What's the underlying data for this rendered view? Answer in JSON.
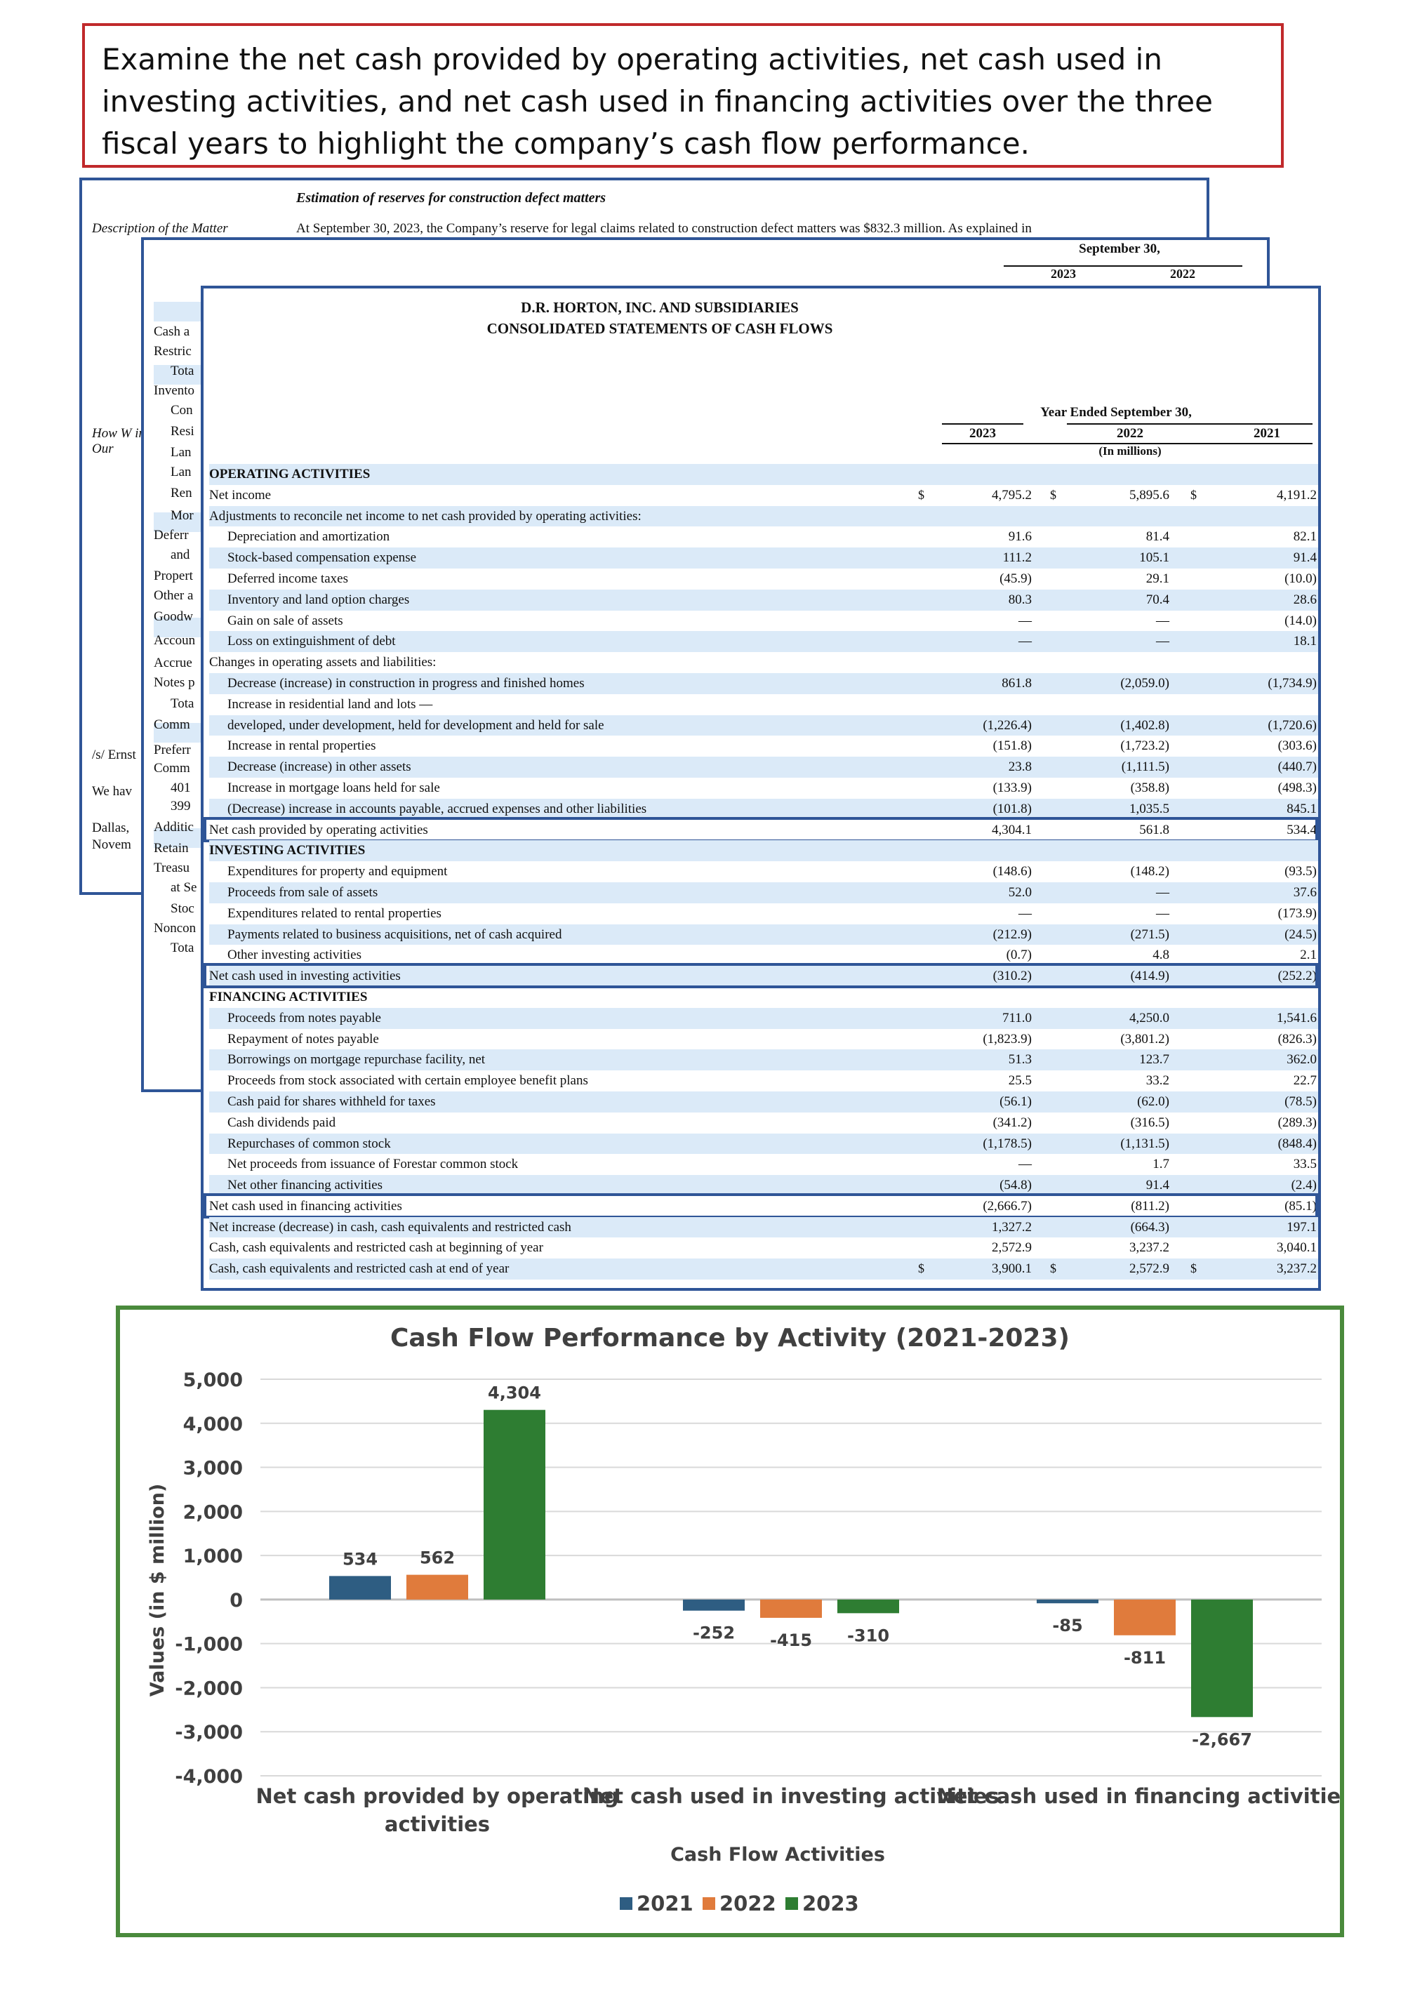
{
  "prompt": {
    "text": "Examine the net cash provided by operating activities, net cash used in investing activities, and net cash used in financing activities over the three fiscal years to highlight the company’s cash flow performance."
  },
  "audit_page": {
    "title": "Estimation of reserves for construction defect matters",
    "description_label": "Description of the Matter",
    "description_text": "At September 30, 2023, the Company’s reserve for legal claims related to construction defect matters was $832.3 million. As explained in",
    "how_label": "How W in Our",
    "left_fragments": [
      "/s/ Ernst",
      "We hav",
      "Dallas,",
      "Novem"
    ]
  },
  "balance_page": {
    "header": "September 30,",
    "years": [
      "2023",
      "2022"
    ],
    "stubs": [
      "Cash a",
      "Restric",
      "Tota",
      "Invento",
      "Con",
      "Resi",
      "Lan",
      "Lan",
      "Ren",
      "Mor",
      "Deferr",
      "and",
      "Propert",
      "Other a",
      "Goodw",
      "Accoun",
      "Accrue",
      "Notes p",
      "Tota",
      "Comm",
      "Preferr",
      "Comm",
      "401",
      "399",
      "Additic",
      "Retain",
      "Treasu",
      "at Se",
      "Stoc",
      "Noncon",
      "Tota"
    ]
  },
  "statement": {
    "title_line1": "D.R. HORTON, INC. AND SUBSIDIARIES",
    "title_line2": "CONSOLIDATED STATEMENTS OF CASH FLOWS",
    "period_header": "Year Ended September 30,",
    "years": [
      "2023",
      "2022",
      "2021"
    ],
    "units": "(In millions)",
    "rows": [
      {
        "label": "OPERATING ACTIVITIES",
        "type": "section"
      },
      {
        "label": "Net income",
        "v2023": "4,795.2",
        "v2022": "5,895.6",
        "v2021": "4,191.2",
        "currency": "$"
      },
      {
        "label": "Adjustments to reconcile net income to net cash provided by operating activities:"
      },
      {
        "label": "Depreciation and amortization",
        "indent": 1,
        "v2023": "91.6",
        "v2022": "81.4",
        "v2021": "82.1"
      },
      {
        "label": "Stock-based compensation expense",
        "indent": 1,
        "v2023": "111.2",
        "v2022": "105.1",
        "v2021": "91.4"
      },
      {
        "label": "Deferred income taxes",
        "indent": 1,
        "v2023": "(45.9)",
        "v2022": "29.1",
        "v2021": "(10.0)"
      },
      {
        "label": "Inventory and land option charges",
        "indent": 1,
        "v2023": "80.3",
        "v2022": "70.4",
        "v2021": "28.6"
      },
      {
        "label": "Gain on sale of assets",
        "indent": 1,
        "v2023": "—",
        "v2022": "—",
        "v2021": "(14.0)"
      },
      {
        "label": "Loss on extinguishment of debt",
        "indent": 1,
        "v2023": "—",
        "v2022": "—",
        "v2021": "18.1"
      },
      {
        "label": "Changes in operating assets and liabilities:"
      },
      {
        "label": "Decrease (increase) in construction in progress and finished homes",
        "indent": 1,
        "v2023": "861.8",
        "v2022": "(2,059.0)",
        "v2021": "(1,734.9)"
      },
      {
        "label": "Increase in residential land and lots —",
        "indent": 1
      },
      {
        "label": "    developed, under development, held for development and held for sale",
        "indent": 1,
        "v2023": "(1,226.4)",
        "v2022": "(1,402.8)",
        "v2021": "(1,720.6)"
      },
      {
        "label": "Increase in rental properties",
        "indent": 1,
        "v2023": "(151.8)",
        "v2022": "(1,723.2)",
        "v2021": "(303.6)"
      },
      {
        "label": "Decrease (increase) in other assets",
        "indent": 1,
        "v2023": "23.8",
        "v2022": "(1,111.5)",
        "v2021": "(440.7)"
      },
      {
        "label": "Increase in mortgage loans held for sale",
        "indent": 1,
        "v2023": "(133.9)",
        "v2022": "(358.8)",
        "v2021": "(498.3)"
      },
      {
        "label": "(Decrease) increase in accounts payable, accrued expenses and other liabilities",
        "indent": 1,
        "v2023": "(101.8)",
        "v2022": "1,035.5",
        "v2021": "845.1"
      },
      {
        "label": "Net cash provided by operating activities",
        "v2023": "4,304.1",
        "v2022": "561.8",
        "v2021": "534.4",
        "total": true
      },
      {
        "label": "INVESTING ACTIVITIES",
        "type": "section"
      },
      {
        "label": "Expenditures for property and equipment",
        "indent": 1,
        "v2023": "(148.6)",
        "v2022": "(148.2)",
        "v2021": "(93.5)"
      },
      {
        "label": "Proceeds from sale of assets",
        "indent": 1,
        "v2023": "52.0",
        "v2022": "—",
        "v2021": "37.6"
      },
      {
        "label": "Expenditures related to rental properties",
        "indent": 1,
        "v2023": "—",
        "v2022": "—",
        "v2021": "(173.9)"
      },
      {
        "label": "Payments related to business acquisitions, net of cash acquired",
        "indent": 1,
        "v2023": "(212.9)",
        "v2022": "(271.5)",
        "v2021": "(24.5)"
      },
      {
        "label": "Other investing activities",
        "indent": 1,
        "v2023": "(0.7)",
        "v2022": "4.8",
        "v2021": "2.1"
      },
      {
        "label": "Net cash used in investing activities",
        "v2023": "(310.2)",
        "v2022": "(414.9)",
        "v2021": "(252.2)",
        "total": true
      },
      {
        "label": "FINANCING ACTIVITIES",
        "type": "section"
      },
      {
        "label": "Proceeds from notes payable",
        "indent": 1,
        "v2023": "711.0",
        "v2022": "4,250.0",
        "v2021": "1,541.6"
      },
      {
        "label": "Repayment of notes payable",
        "indent": 1,
        "v2023": "(1,823.9)",
        "v2022": "(3,801.2)",
        "v2021": "(826.3)"
      },
      {
        "label": "Borrowings on mortgage repurchase facility, net",
        "indent": 1,
        "v2023": "51.3",
        "v2022": "123.7",
        "v2021": "362.0"
      },
      {
        "label": "Proceeds from stock associated with certain employee benefit plans",
        "indent": 1,
        "v2023": "25.5",
        "v2022": "33.2",
        "v2021": "22.7"
      },
      {
        "label": "Cash paid for shares withheld for taxes",
        "indent": 1,
        "v2023": "(56.1)",
        "v2022": "(62.0)",
        "v2021": "(78.5)"
      },
      {
        "label": "Cash dividends paid",
        "indent": 1,
        "v2023": "(341.2)",
        "v2022": "(316.5)",
        "v2021": "(289.3)"
      },
      {
        "label": "Repurchases of common stock",
        "indent": 1,
        "v2023": "(1,178.5)",
        "v2022": "(1,131.5)",
        "v2021": "(848.4)"
      },
      {
        "label": "Net proceeds from issuance of Forestar common stock",
        "indent": 1,
        "v2023": "—",
        "v2022": "1.7",
        "v2021": "33.5"
      },
      {
        "label": "Net other financing activities",
        "indent": 1,
        "v2023": "(54.8)",
        "v2022": "91.4",
        "v2021": "(2.4)"
      },
      {
        "label": "Net cash used in financing activities",
        "v2023": "(2,666.7)",
        "v2022": "(811.2)",
        "v2021": "(85.1)",
        "total": true
      },
      {
        "label": "Net increase (decrease) in cash, cash equivalents and restricted cash",
        "v2023": "1,327.2",
        "v2022": "(664.3)",
        "v2021": "197.1"
      },
      {
        "label": "Cash, cash equivalents and restricted cash at beginning of year",
        "v2023": "2,572.9",
        "v2022": "3,237.2",
        "v2021": "3,040.1"
      },
      {
        "label": "Cash, cash equivalents and restricted cash at end of year",
        "v2023": "3,900.1",
        "v2022": "2,572.9",
        "v2021": "3,237.2",
        "currency": "$"
      }
    ]
  },
  "chart_data": {
    "type": "bar",
    "title": "Cash Flow Performance by Activity (2021-2023)",
    "xlabel": "Cash Flow Activities",
    "ylabel": "Values (in $ million)",
    "categories": [
      "Net cash provided by operating activities",
      "Net cash used in investing activities",
      "Net cash used in financing activities"
    ],
    "category_lines": [
      [
        "Net cash provided by operating",
        "activities"
      ],
      [
        "Net cash used in investing activities"
      ],
      [
        "Net cash used in financing activities"
      ]
    ],
    "series": [
      {
        "name": "2021",
        "color": "#2e5d82",
        "values": [
          534,
          -252,
          -85
        ],
        "labels": [
          "534",
          "-252",
          "-85"
        ]
      },
      {
        "name": "2022",
        "color": "#e07b3c",
        "values": [
          562,
          -415,
          -811
        ],
        "labels": [
          "562",
          "-415",
          "-811"
        ]
      },
      {
        "name": "2023",
        "color": "#2e7d32",
        "values": [
          4304,
          -310,
          -2667
        ],
        "labels": [
          "4,304",
          "-310",
          "-2,667"
        ]
      }
    ],
    "ylim": [
      -4000,
      5000
    ],
    "yticks": [
      5000,
      4000,
      3000,
      2000,
      1000,
      0,
      -1000,
      -2000,
      -3000,
      -4000
    ],
    "ytick_labels": [
      "5,000",
      "4,000",
      "3,000",
      "2,000",
      "1,000",
      "0",
      "-1,000",
      "-2,000",
      "-3,000",
      "-4,000"
    ],
    "grid": true,
    "legend": "bottom"
  }
}
